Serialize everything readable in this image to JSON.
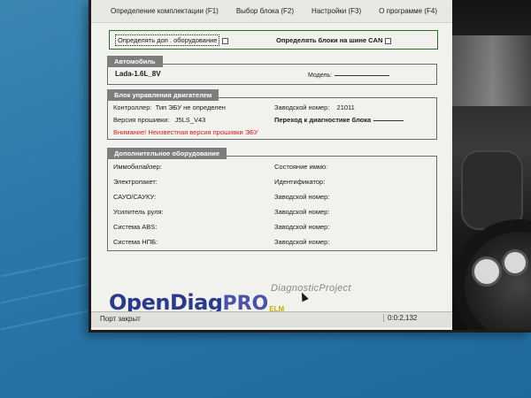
{
  "menu": {
    "items": [
      "Определение комплектации (F1)",
      "Выбор блока (F2)",
      "Настройки (F3)",
      "О программе (F4)"
    ]
  },
  "detect": {
    "extra_equipment": "Определять доп . оборудование",
    "can_blocks": "Определять блоки на шине CAN"
  },
  "car": {
    "title": "Автомобиль",
    "name": "Lada-1.6L_8V",
    "model_label": "Модель:"
  },
  "ecu": {
    "title": "Блок управления двигателем",
    "controller_label": "Контроллер:",
    "controller_value": "Тип ЭБУ не определен",
    "serial_label": "Заводской номер:",
    "serial_value": "21011",
    "firmware_label": "Версия прошивки:",
    "firmware_value": "J5LS_V43",
    "goto_label": "Переход к диагностике блока",
    "warning": "Внимание! Неизвестная версия прошивки ЭБУ"
  },
  "extra": {
    "title": "Дополнительное оборудование",
    "rows": [
      {
        "left": "Иммобилайзер:",
        "right": "Состояние иммо:"
      },
      {
        "left": "Электропакет:",
        "right": "Идентификатор:"
      },
      {
        "left": "САУО/САУКУ:",
        "right": "Заводской номер:"
      },
      {
        "left": "Усилитель руля:",
        "right": "Заводской номер:"
      },
      {
        "left": "Система ABS:",
        "right": "Заводской номер:"
      },
      {
        "left": "Система НПБ:",
        "right": "Заводской номер:"
      }
    ]
  },
  "logo": {
    "open": "OpenDiag",
    "pro": "PRO",
    "elm": "ELM",
    "subtitle": "DiagnosticProject"
  },
  "status": {
    "port": "Порт закрыт",
    "time": "0:0:2,132"
  }
}
